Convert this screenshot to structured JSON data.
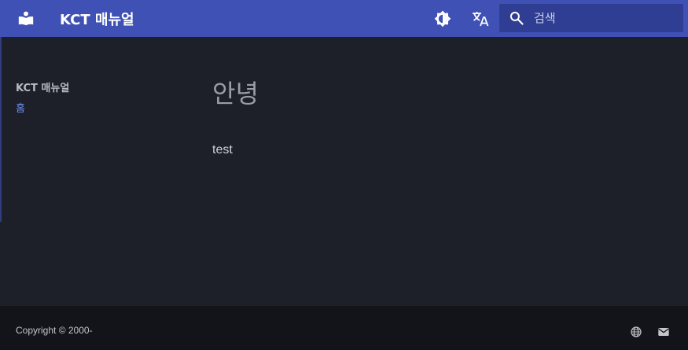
{
  "header": {
    "site_title": "KCT 매뉴얼",
    "search_placeholder": "검색"
  },
  "sidebar": {
    "title": "KCT 매뉴얼",
    "items": [
      {
        "label": "홈"
      }
    ]
  },
  "main": {
    "title": "안녕",
    "body": "test"
  },
  "footer": {
    "copyright": "Copyright © 2000-"
  },
  "icons": {
    "logo": "book-reader-icon",
    "theme": "brightness-icon",
    "language": "translate-icon",
    "search": "search-icon",
    "globe": "globe-icon",
    "mail": "mail-icon"
  },
  "colors": {
    "primary": "#3f51b5",
    "background": "#1e2029",
    "footer": "#131419",
    "link": "#6c8cf0"
  }
}
